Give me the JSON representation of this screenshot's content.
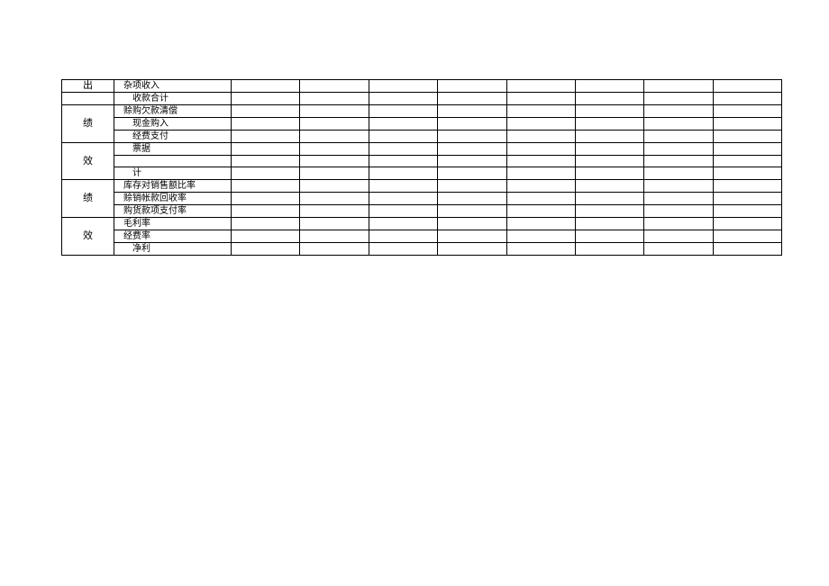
{
  "sections": [
    {
      "header_top": "出",
      "header_bottom": "",
      "rows": [
        {
          "label": "杂项收入",
          "indent": false
        },
        {
          "label": "收款合计",
          "indent": true
        }
      ]
    },
    {
      "header_top": "绩",
      "header_bottom": "效",
      "rows": [
        {
          "label": "赊购欠款清偿",
          "indent": false
        },
        {
          "label": "现金购入",
          "indent": true
        },
        {
          "label": "经费支付",
          "indent": true
        },
        {
          "label": "票据",
          "indent": true
        },
        {
          "label": "",
          "indent": false
        },
        {
          "label": "计",
          "indent": true
        }
      ]
    },
    {
      "header_top": "绩",
      "header_bottom": "效",
      "rows": [
        {
          "label": "库存对销售额比率",
          "indent": false
        },
        {
          "label": "赊销帐款回收率",
          "indent": false
        },
        {
          "label": "购货款项支付率",
          "indent": false
        },
        {
          "label": "毛利率",
          "indent": false
        },
        {
          "label": "经费率",
          "indent": false
        },
        {
          "label": "净利",
          "indent": true
        }
      ]
    }
  ]
}
